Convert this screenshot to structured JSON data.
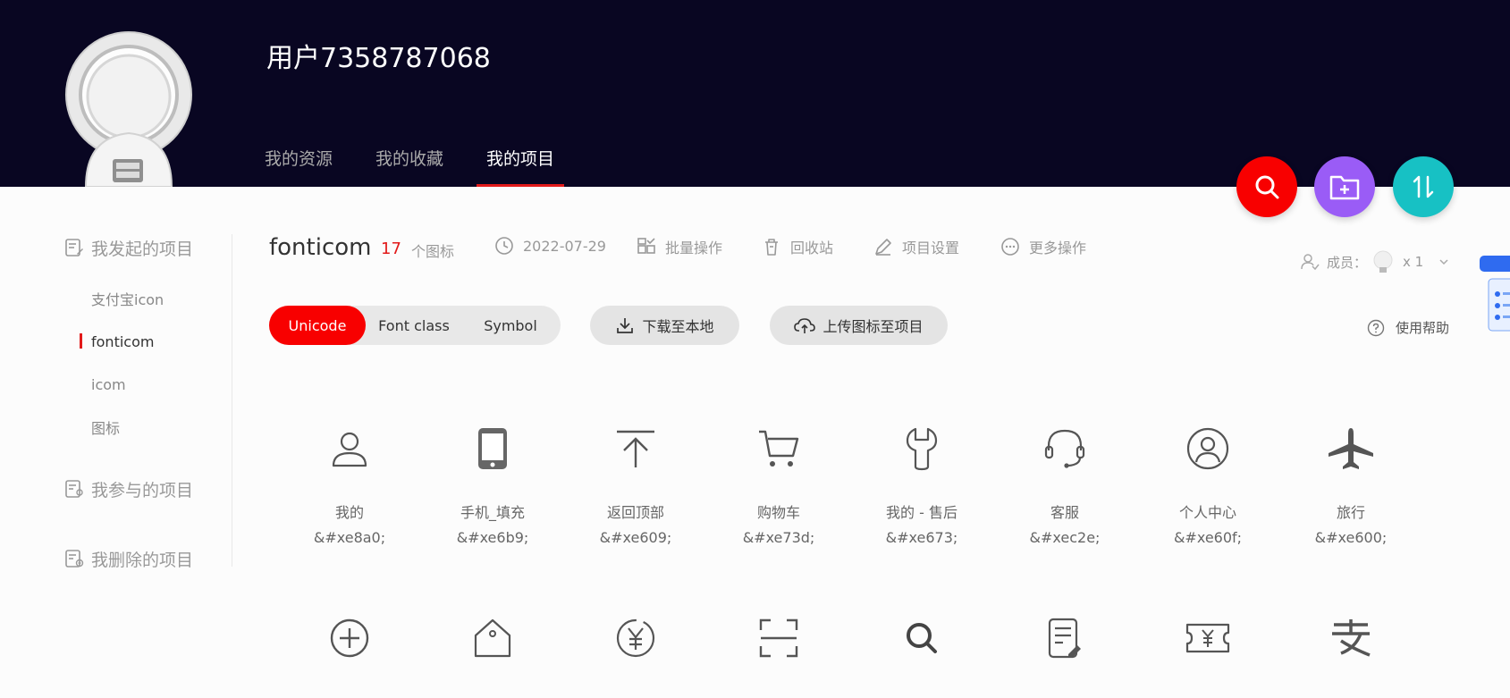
{
  "header": {
    "username": "用户7358787068",
    "tabs": [
      "我的资源",
      "我的收藏",
      "我的项目"
    ],
    "active_tab": 2
  },
  "fab": {
    "search_icon": "search-icon",
    "new_folder_icon": "folder-plus-icon",
    "sort_icon": "sort-icon",
    "colors": {
      "search": "#f80000",
      "folder": "#9a5cf6",
      "sort": "#17c1c4"
    }
  },
  "sidebar": {
    "started_title": "我发起的项目",
    "started_items": [
      "支付宝icon",
      "fonticom",
      "icom",
      "图标"
    ],
    "active_item": "fonticom",
    "joined_title": "我参与的项目",
    "deleted_title": "我删除的项目"
  },
  "project": {
    "name": "fonticom",
    "icon_count": "17",
    "icon_count_label": "个图标",
    "date": "2022-07-29",
    "batch": "批量操作",
    "recycle": "回收站",
    "settings": "项目设置",
    "more": "更多操作"
  },
  "members": {
    "label": "成员：",
    "count": "x 1"
  },
  "help": {
    "label": "使用帮助"
  },
  "modes": {
    "unicode": "Unicode",
    "font_class": "Font class",
    "symbol": "Symbol",
    "active": "Unicode"
  },
  "actions": {
    "download": "下载至本地",
    "upload": "上传图标至项目"
  },
  "icons": [
    {
      "name": "我的",
      "code": "&#xe8a0;",
      "icon": "user-icon"
    },
    {
      "name": "手机_填充",
      "code": "&#xe6b9;",
      "icon": "phone-icon"
    },
    {
      "name": "返回顶部",
      "code": "&#xe609;",
      "icon": "back-to-top-icon"
    },
    {
      "name": "购物车",
      "code": "&#xe73d;",
      "icon": "cart-icon"
    },
    {
      "name": "我的 - 售后",
      "code": "&#xe673;",
      "icon": "wrench-icon"
    },
    {
      "name": "客服",
      "code": "&#xec2e;",
      "icon": "headset-icon"
    },
    {
      "name": "个人中心",
      "code": "&#xe60f;",
      "icon": "user-circle-icon"
    },
    {
      "name": "旅行",
      "code": "&#xe600;",
      "icon": "plane-icon"
    },
    {
      "icon": "plus-circle-icon"
    },
    {
      "icon": "house-tag-icon"
    },
    {
      "icon": "yuan-circle-icon"
    },
    {
      "icon": "scan-icon"
    },
    {
      "icon": "search-icon"
    },
    {
      "icon": "document-edit-icon"
    },
    {
      "icon": "yuan-ticket-icon"
    },
    {
      "icon": "alipay-icon"
    }
  ]
}
